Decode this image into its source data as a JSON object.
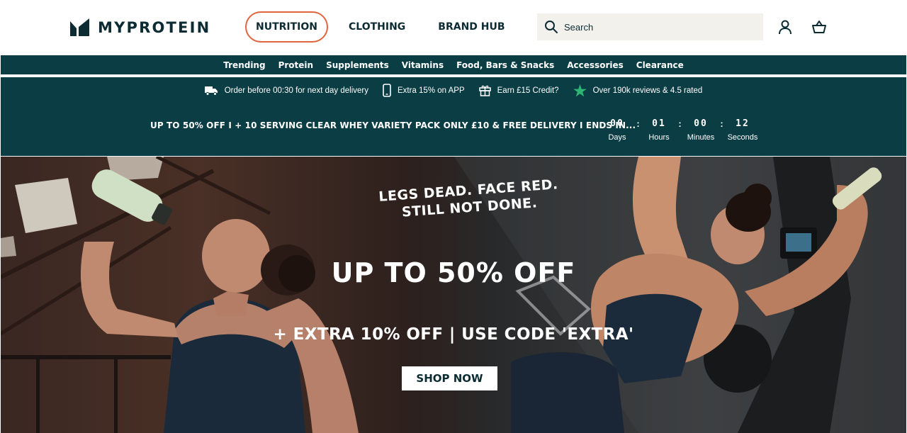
{
  "brand": {
    "name": "MYPROTEIN"
  },
  "nav": [
    {
      "label": "NUTRITION",
      "active": true
    },
    {
      "label": "CLOTHING",
      "active": false
    },
    {
      "label": "BRAND HUB",
      "active": false
    }
  ],
  "search": {
    "placeholder": "Search"
  },
  "categories": [
    "Trending",
    "Protein",
    "Supplements",
    "Vitamins",
    "Food, Bars & Snacks",
    "Accessories",
    "Clearance"
  ],
  "usps": [
    {
      "icon": "truck-icon",
      "text": "Order before 00:30 for next day delivery"
    },
    {
      "icon": "phone-icon",
      "text": "Extra 15% on APP"
    },
    {
      "icon": "gift-icon",
      "text": "Earn £15 Credit?"
    },
    {
      "icon": "star-icon",
      "text": "Over 190k reviews & 4.5 rated"
    }
  ],
  "promo": {
    "ticker": "UP TO 50% OFF I + 10 SERVING CLEAR WHEY VARIETY PACK ONLY £10 & FREE DELIVERY I ENDS IN...",
    "countdown": [
      {
        "value": "00",
        "label": "Days"
      },
      {
        "value": "01",
        "label": "Hours"
      },
      {
        "value": "00",
        "label": "Minutes"
      },
      {
        "value": "12",
        "label": "Seconds"
      }
    ],
    "separator": ":"
  },
  "hero": {
    "tagline_1": "LEGS DEAD. FACE RED.",
    "tagline_2": "STILL NOT DONE.",
    "headline": "UP TO 50% OFF",
    "subline": "+  EXTRA 10% OFF | USE CODE 'EXTRA'",
    "cta": "SHOP NOW"
  },
  "colors": {
    "brand_teal": "#0b3d44",
    "accent_orange": "#e0643d",
    "search_bg": "#f2f1ec",
    "star_green": "#2bb673"
  }
}
